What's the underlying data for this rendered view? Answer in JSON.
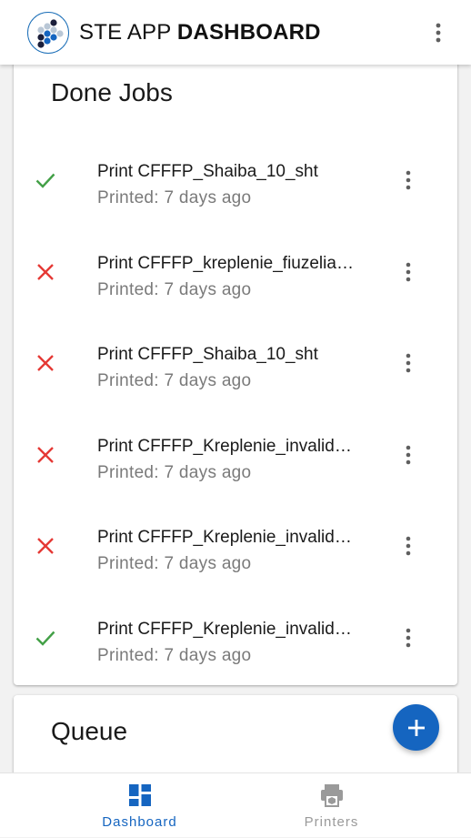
{
  "app_bar": {
    "title_regular": "STE APP ",
    "title_bold": "DASHBOARD",
    "menu_icon": "more-vert-icon"
  },
  "done_jobs": {
    "title": "Done Jobs",
    "items": [
      {
        "title": "Print CFFFP_Shaiba_10_sht",
        "subtitle": "Printed: 7 days ago",
        "status": "success"
      },
      {
        "title": "Print CFFFP_kreplenie_fiuzeliazh_krylo",
        "subtitle": "Printed: 7 days ago",
        "status": "failed"
      },
      {
        "title": "Print CFFFP_Shaiba_10_sht",
        "subtitle": "Printed: 7 days ago",
        "status": "failed"
      },
      {
        "title": "Print CFFFP_Kreplenie_invalid_krylo",
        "subtitle": "Printed: 7 days ago",
        "status": "failed"
      },
      {
        "title": "Print CFFFP_Kreplenie_invalid_krylo",
        "subtitle": "Printed: 7 days ago",
        "status": "failed"
      },
      {
        "title": "Print CFFFP_Kreplenie_invalid_krylo",
        "subtitle": "Printed: 7 days ago",
        "status": "success"
      }
    ]
  },
  "queue": {
    "title": "Queue",
    "add_icon": "plus-icon"
  },
  "bottom_nav": {
    "items": [
      {
        "label": "Dashboard",
        "icon": "dashboard-icon",
        "active": true
      },
      {
        "label": "Printers",
        "icon": "printer-icon",
        "active": false
      }
    ]
  },
  "colors": {
    "accent": "#1565c0",
    "success": "#43a047",
    "error": "#e53935"
  }
}
